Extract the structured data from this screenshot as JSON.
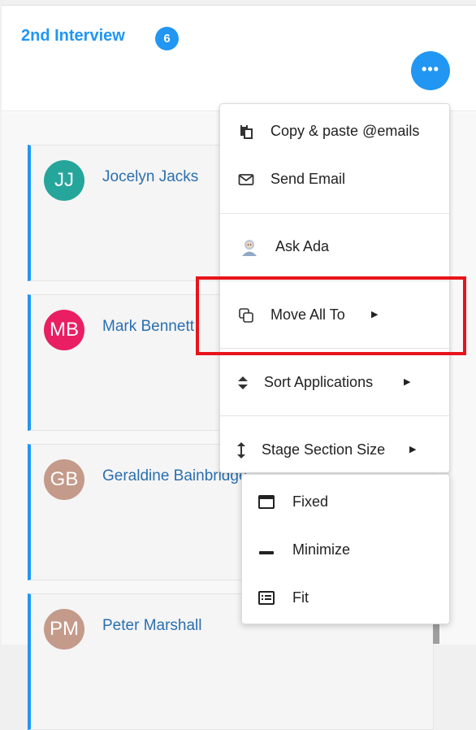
{
  "header": {
    "stage_title": "2nd Interview",
    "count": "6",
    "more_icon": "ellipsis-icon",
    "more_label": "•••"
  },
  "candidates": [
    {
      "initials": "JJ",
      "name": "Jocelyn Jacks",
      "color": "#26a69a"
    },
    {
      "initials": "MB",
      "name": "Mark Bennett",
      "color": "#e91e63"
    },
    {
      "initials": "GB",
      "name": "Geraldine Bainbridge",
      "color": "#c49a8a"
    },
    {
      "initials": "PM",
      "name": "Peter Marshall",
      "color": "#c49a8a"
    }
  ],
  "menu": {
    "items": [
      {
        "label": "Copy & paste @emails",
        "icon": "clipboard-icon"
      },
      {
        "label": "Send Email",
        "icon": "envelope-icon"
      },
      {
        "label": "Ask Ada",
        "icon": "assistant-avatar-icon"
      },
      {
        "label": "Move All To",
        "icon": "copy-icon"
      },
      {
        "label": "Sort Applications",
        "icon": "sort-icon"
      },
      {
        "label": "Stage Section Size",
        "icon": "vertical-resize-icon"
      }
    ]
  },
  "submenu": {
    "items": [
      {
        "label": "Fixed",
        "icon": "window-icon"
      },
      {
        "label": "Minimize",
        "icon": "minus-icon"
      },
      {
        "label": "Fit",
        "icon": "list-fit-icon"
      }
    ]
  },
  "colors": {
    "accent": "#2196f3",
    "highlight": "#e8141b",
    "link": "#2a6fb0"
  }
}
